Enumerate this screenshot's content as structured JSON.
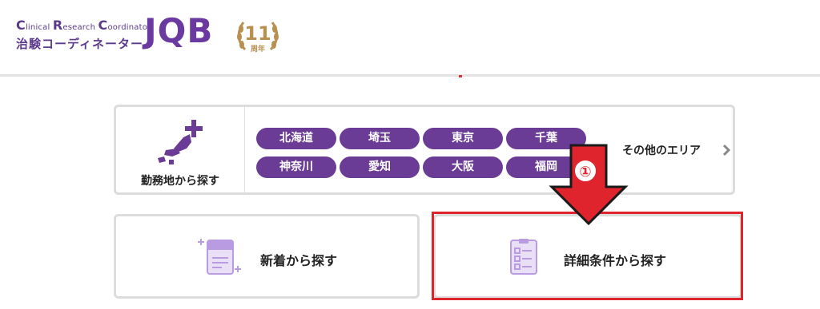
{
  "header": {
    "logo_en_parts": [
      {
        "cap": "C",
        "rest": "linical "
      },
      {
        "cap": "R",
        "rest": "esearch "
      },
      {
        "cap": "C",
        "rest": "oordinator"
      }
    ],
    "logo_jp": "治験コーディネーター",
    "logo_brand": "JQB",
    "anniversary_number": "11",
    "anniversary_suffix": "周年"
  },
  "area_search": {
    "label": "勤務地から探す",
    "prefectures": [
      "北海道",
      "埼玉",
      "東京",
      "千葉",
      "神奈川",
      "愛知",
      "大阪",
      "福岡"
    ],
    "other_label": "その他のエリア"
  },
  "cards": {
    "new_label": "新着から探す",
    "detail_label": "詳細条件から探す"
  },
  "annotation": {
    "step": "①"
  },
  "colors": {
    "brand_purple": "#6a3c96",
    "highlight_red": "#e0242d",
    "anniversary_gold": "#b89050",
    "icon_lavender": "#b89be0"
  }
}
